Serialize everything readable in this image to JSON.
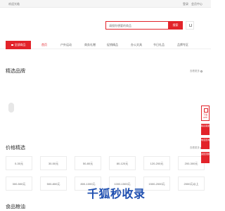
{
  "topbar": {
    "welcome": "欢迎光临",
    "login": "登录",
    "member_center": "会员中心"
  },
  "search": {
    "placeholder": "请搜你想要的商品",
    "button_label": "搜索"
  },
  "cart": {
    "icon": "cart-icon"
  },
  "nav": {
    "all_categories_label": "全部商品",
    "items": [
      {
        "label": "首页"
      },
      {
        "label": "户外运动"
      },
      {
        "label": "商务礼赠"
      },
      {
        "label": "促销精品"
      },
      {
        "label": "办公文具"
      },
      {
        "label": "节日礼品"
      },
      {
        "label": "品牌专区"
      }
    ],
    "active_index": 0
  },
  "sections": {
    "brands": {
      "title": "精选品牌",
      "more": "查看更多"
    },
    "price": {
      "title": "价格精选",
      "more": "查看更多"
    },
    "bottom": {
      "title": "食品粮油"
    }
  },
  "price_ranges": [
    "0-30元",
    "30-50元",
    "50-80元",
    "80-120元",
    "120-200元",
    "200-300元",
    "300-500元",
    "500-800元",
    "800-1000元",
    "1000-1500元",
    "1500-2000元",
    "2000元以上"
  ],
  "side_panel": {
    "top_white_label": "下载APP",
    "buttons": [
      "联系客服",
      "电话咨询",
      "返回顶部"
    ]
  },
  "watermark": "千狐秒收录",
  "colors": {
    "accent": "#e2232a",
    "watermark": "#1f4fb0"
  }
}
